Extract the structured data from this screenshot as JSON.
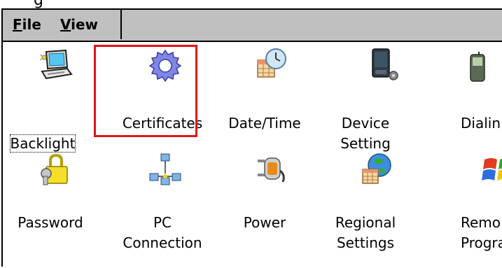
{
  "title_fragment": "g",
  "menu": [
    {
      "label": "File",
      "accel": "F",
      "rest": "ile"
    },
    {
      "label": "View",
      "accel": "V",
      "rest": "iew"
    }
  ],
  "items": [
    {
      "name": "backlight",
      "label": "Backlight"
    },
    {
      "name": "certificates",
      "label": "Certificates"
    },
    {
      "name": "date-time",
      "label": "Date/Time"
    },
    {
      "name": "device-setting",
      "label": "Device\nSetting"
    },
    {
      "name": "dialing",
      "label": "Dialin"
    },
    {
      "name": "password",
      "label": "Password"
    },
    {
      "name": "pc-connection",
      "label": "PC\nConnection"
    },
    {
      "name": "power",
      "label": "Power"
    },
    {
      "name": "regional-settings",
      "label": "Regional\nSettings"
    },
    {
      "name": "remove-programs",
      "label": "Remo\nProgra"
    }
  ],
  "highlight_color": "#e0141a"
}
